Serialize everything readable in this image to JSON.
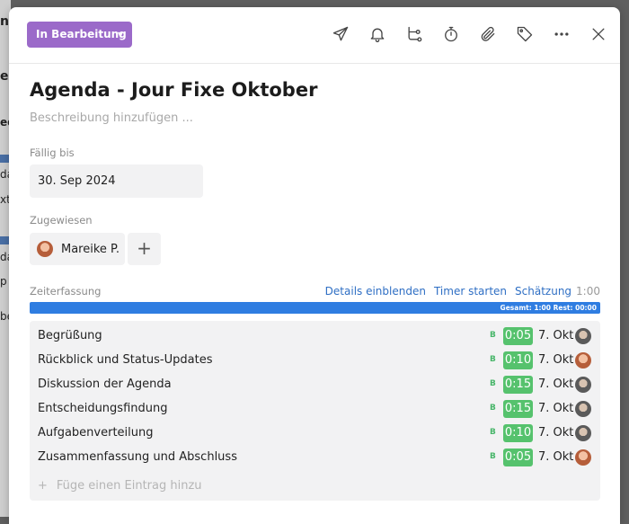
{
  "background": {
    "fragments": [
      "n",
      "e A",
      "ed",
      "da",
      "xt",
      "da",
      "p",
      "be"
    ]
  },
  "header": {
    "status_label": "In Bearbeitung",
    "status_color": "#9b6ac9",
    "icons": [
      "send-icon",
      "bell-icon",
      "branch-icon",
      "timer-icon",
      "paperclip-icon",
      "tag-icon",
      "more-icon",
      "close-icon"
    ]
  },
  "task": {
    "title": "Agenda - Jour Fixe Oktober",
    "description_placeholder": "Beschreibung hinzufügen ..."
  },
  "due": {
    "label": "Fällig bis",
    "value": "30. Sep 2024"
  },
  "assigned": {
    "label": "Zugewiesen",
    "name": "Mareike P.",
    "add": "+"
  },
  "time_tracking": {
    "label": "Zeiterfassung",
    "details_link": "Details einblenden",
    "timer_link": "Timer starten",
    "estimate_link": "Schätzung",
    "estimate_value": "1:00",
    "progress_text": "Gesamt: 1:00   Rest: 00:00",
    "progress_fraction": 1.0,
    "bar_color": "#2f7de1",
    "badge_color": "#56c26d"
  },
  "entries": [
    {
      "name": "Begrüßung",
      "flag": "B",
      "duration": "0:05",
      "date": "7. Okt",
      "avatar": "male"
    },
    {
      "name": "Rückblick und Status-Updates",
      "flag": "B",
      "duration": "0:10",
      "date": "7. Okt",
      "avatar": "female"
    },
    {
      "name": "Diskussion der Agenda",
      "flag": "B",
      "duration": "0:15",
      "date": "7. Okt",
      "avatar": "male"
    },
    {
      "name": "Entscheidungsfindung",
      "flag": "B",
      "duration": "0:15",
      "date": "7. Okt",
      "avatar": "male"
    },
    {
      "name": "Aufgabenverteilung",
      "flag": "B",
      "duration": "0:10",
      "date": "7. Okt",
      "avatar": "male"
    },
    {
      "name": "Zusammenfassung und Abschluss",
      "flag": "B",
      "duration": "0:05",
      "date": "7. Okt",
      "avatar": "female"
    }
  ],
  "add_entry": {
    "plus": "+",
    "placeholder": "Füge einen Eintrag hinzu"
  }
}
